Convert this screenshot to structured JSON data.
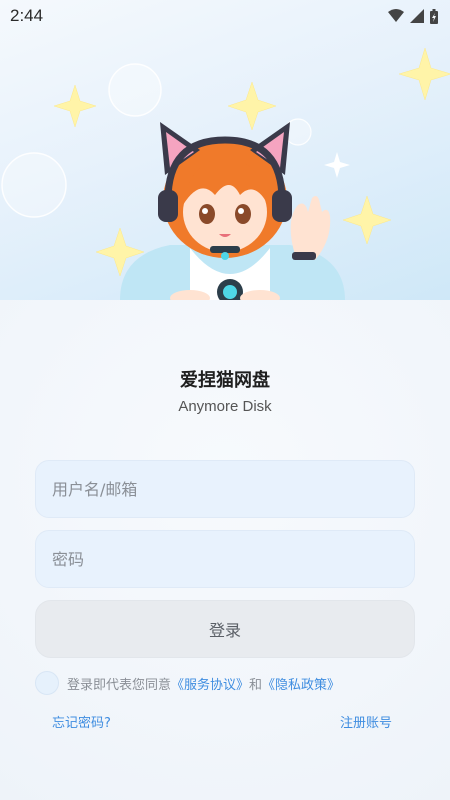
{
  "status": {
    "time": "2:44",
    "icons": [
      "wifi-icon",
      "signal-icon",
      "battery-icon"
    ]
  },
  "app": {
    "name": "爱捏猫网盘",
    "subtitle": "Anymore Disk"
  },
  "form": {
    "username_placeholder": "用户名/邮箱",
    "password_placeholder": "密码",
    "login_label": "登录"
  },
  "agreement": {
    "prefix": "登录即代表您同意",
    "terms": "《服务协议》",
    "and": "和",
    "privacy": "《隐私政策》",
    "checked": false
  },
  "links": {
    "forgot": "忘记密码?",
    "register": "注册账号"
  },
  "colors": {
    "accent": "#3f8de0",
    "field_bg": "#e8f2fd",
    "button_bg": "#e8ebef"
  }
}
